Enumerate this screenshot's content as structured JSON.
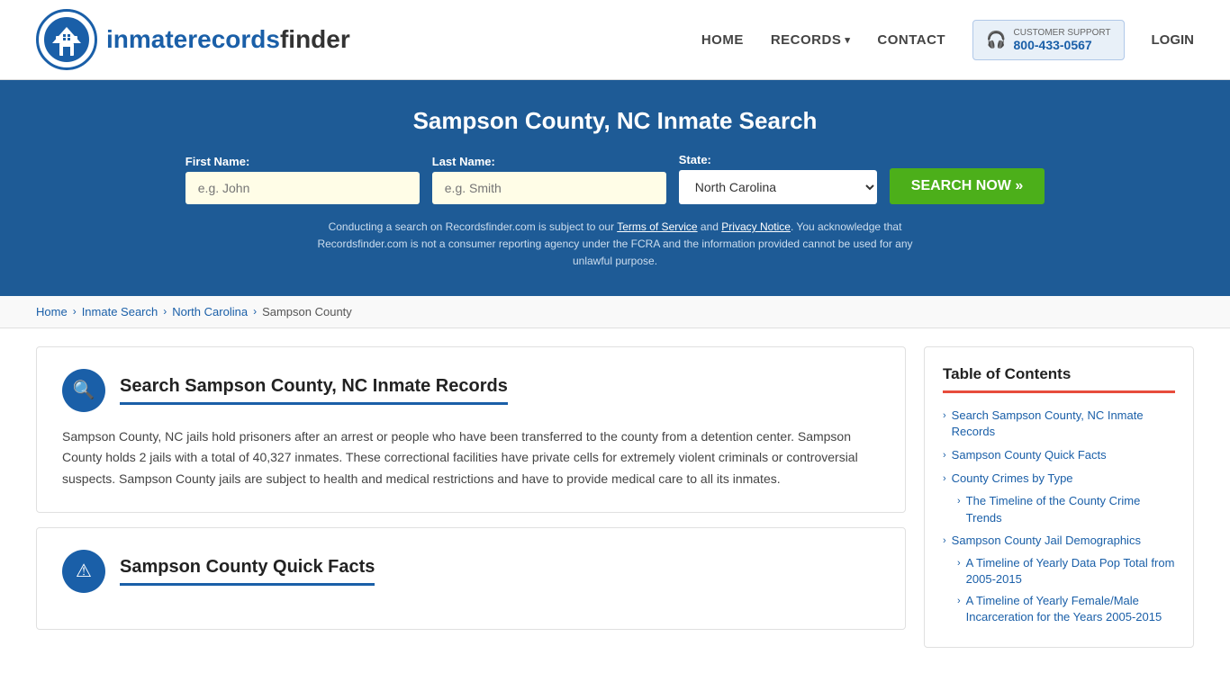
{
  "header": {
    "logo_text_main": "inmaterecords",
    "logo_text_bold": "finder",
    "nav": {
      "home": "HOME",
      "records": "RECORDS",
      "contact": "CONTACT",
      "login": "LOGIN"
    },
    "support": {
      "label": "CUSTOMER SUPPORT",
      "number": "800-433-0567"
    }
  },
  "hero": {
    "title": "Sampson County, NC Inmate Search",
    "form": {
      "first_name_label": "First Name:",
      "first_name_placeholder": "e.g. John",
      "last_name_label": "Last Name:",
      "last_name_placeholder": "e.g. Smith",
      "state_label": "State:",
      "state_value": "North Carolina",
      "search_btn": "SEARCH NOW »"
    },
    "disclaimer": "Conducting a search on Recordsfinder.com is subject to our Terms of Service and Privacy Notice. You acknowledge that Recordsfinder.com is not a consumer reporting agency under the FCRA and the information provided cannot be used for any unlawful purpose."
  },
  "breadcrumb": {
    "home": "Home",
    "inmate_search": "Inmate Search",
    "state": "North Carolina",
    "county": "Sampson County"
  },
  "sections": [
    {
      "id": "inmate-records",
      "icon": "🔍",
      "title": "Search Sampson County, NC Inmate Records",
      "body": "Sampson County, NC jails hold prisoners after an arrest or people who have been transferred to the county from a detention center. Sampson County holds 2 jails with a total of 40,327 inmates. These correctional facilities have private cells for extremely violent criminals or controversial suspects. Sampson County jails are subject to health and medical restrictions and have to provide medical care to all its inmates."
    },
    {
      "id": "quick-facts",
      "icon": "⚠",
      "title": "Sampson County Quick Facts",
      "body": ""
    }
  ],
  "toc": {
    "title": "Table of Contents",
    "items": [
      {
        "label": "Search Sampson County, NC Inmate Records",
        "sub": false
      },
      {
        "label": "Sampson County Quick Facts",
        "sub": false
      },
      {
        "label": "County Crimes by Type",
        "sub": false
      },
      {
        "label": "The Timeline of the County Crime Trends",
        "sub": true,
        "indent": true
      },
      {
        "label": "Sampson County Jail Demographics",
        "sub": false
      },
      {
        "label": "A Timeline of Yearly Data Pop Total from 2005-2015",
        "sub": true,
        "indent": true
      },
      {
        "label": "A Timeline of Yearly Female/Male Incarceration for the Years 2005-2015",
        "sub": true,
        "indent": true
      }
    ]
  }
}
